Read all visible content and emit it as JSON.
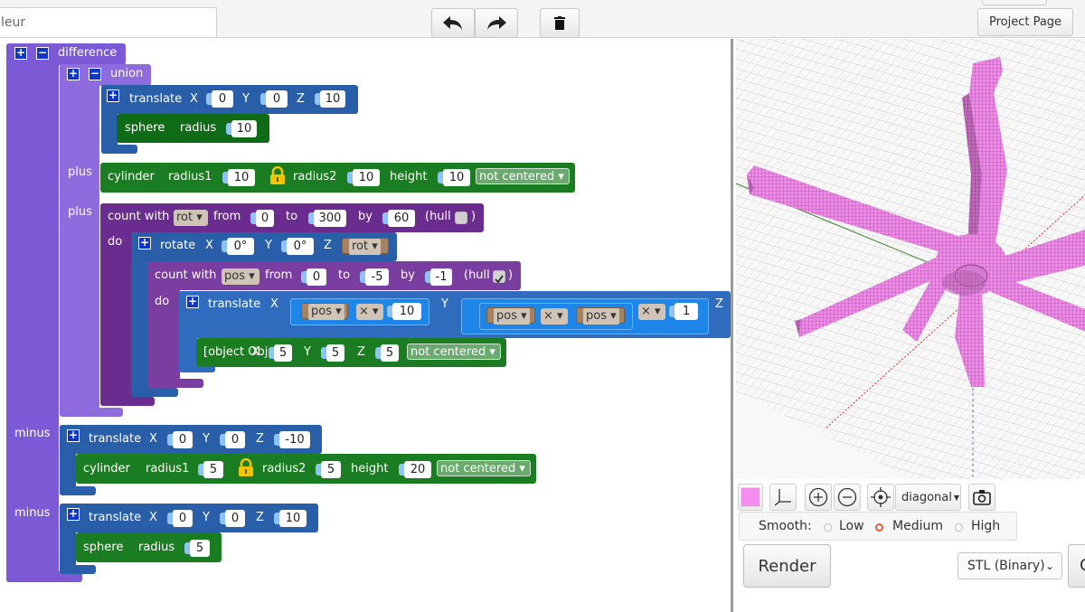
{
  "toolbar": {
    "search_placeholder": "leur",
    "project_page_label": "Project Page",
    "icons": [
      "undo-icon",
      "redo-icon",
      "trash-icon"
    ]
  },
  "blocks": {
    "difference": "difference",
    "union": "union",
    "translate": "translate",
    "sphere": "sphere",
    "radius": "radius",
    "cylinder": "cylinder",
    "radius1": "radius1",
    "radius2": "radius2",
    "height": "height",
    "not_centered": "not centered ▾",
    "plus": "plus",
    "minus": "minus",
    "count_with": "count with",
    "from": "from",
    "to": "to",
    "by": "by",
    "hull_open": "(hull",
    "hull_close": ")",
    "do": "do",
    "rotate": "rotate",
    "cube": {
      "x": "5",
      "y": "5",
      "z": "5"
    },
    "x": "X",
    "y": "Y",
    "z": "Z",
    "times": "× ▾",
    "rot_var": "rot ▾",
    "pos_var": "pos ▾",
    "t1": {
      "x": "0",
      "y": "0",
      "z": "10"
    },
    "sphere1_radius": "10",
    "cyl1": {
      "r1": "10",
      "r2": "10",
      "h": "10"
    },
    "loop1": {
      "from": "0",
      "to": "300",
      "by": "60"
    },
    "rot": {
      "x": "0°",
      "y": "0°"
    },
    "loop2": {
      "from": "0",
      "to": "-5",
      "by": "-1"
    },
    "t2": {
      "xmul": "10",
      "ymul": "1"
    },
    "t3": {
      "x": "0",
      "y": "0",
      "z": "-10"
    },
    "cyl2": {
      "r1": "5",
      "r2": "5",
      "h": "20"
    },
    "t4": {
      "x": "0",
      "y": "0",
      "z": "10"
    },
    "sphere2_radius": "5"
  },
  "viewer": {
    "view_mode": "diagonal",
    "smooth_label": "Smooth:",
    "smooth_options": [
      "Low",
      "Medium",
      "High"
    ],
    "smooth_selected": "Medium",
    "render_label": "Render",
    "export_format": "STL (Binary)",
    "extra_button_label": "C",
    "model_color": "#f58cf0"
  }
}
